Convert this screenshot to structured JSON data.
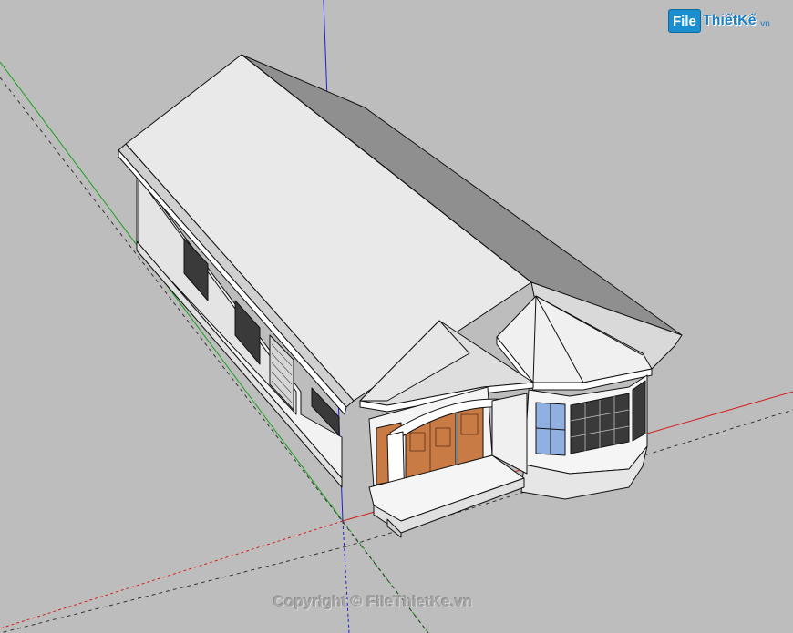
{
  "logo": {
    "box": "File",
    "rest": "ThiếtKế",
    "tld": ".vn"
  },
  "watermark": "Copyright © FileThietKe.vn",
  "viewport": {
    "background": "#bdbdbd",
    "axis_colors": {
      "x": "#d42020",
      "y": "#19a019",
      "z": "#2020d0"
    },
    "wall_color": "#f2f2f2",
    "roof_color": "#e9e9e9",
    "roof_shade_color": "#8f8f8f",
    "door_color": "#c87b45",
    "window_color": "#3a3a3a",
    "glass_color": "#8fb0e0"
  }
}
